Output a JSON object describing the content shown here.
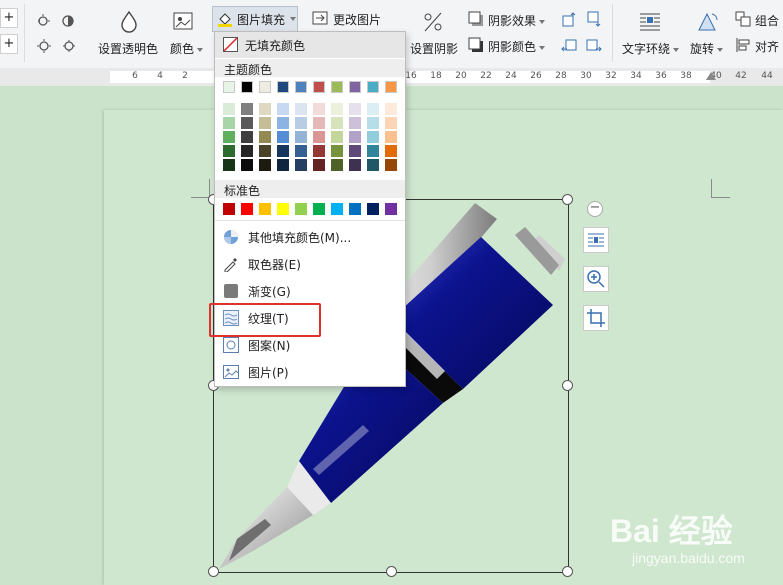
{
  "ribbon": {
    "set_transparent": "设置透明色",
    "color": "颜色",
    "picture_fill": "图片填充",
    "change_picture": "更改图片",
    "shadow_effect": "阴影效果",
    "set_shadow": "设置阴影",
    "shadow_color": "阴影颜色",
    "text_wrap": "文字环绕",
    "rotate": "旋转",
    "group": "组合",
    "align": "对齐"
  },
  "ruler": {
    "left_ticks": [
      "6",
      "4",
      "2"
    ],
    "right_ticks": [
      "16",
      "18",
      "20",
      "22",
      "24",
      "26",
      "28",
      "30",
      "32",
      "34",
      "36",
      "38",
      "40",
      "42",
      "44"
    ]
  },
  "menu": {
    "no_fill": "无填充颜色",
    "theme_colors": "主题颜色",
    "standard_colors": "标准色",
    "more_colors": "其他填充颜色(M)...",
    "eyedropper": "取色器(E)",
    "gradient": "渐变(G)",
    "texture": "纹理(T)",
    "pattern": "图案(N)",
    "picture": "图片(P)"
  },
  "theme_top_row": [
    "#e8f3e8",
    "#000000",
    "#eeece1",
    "#1f497d",
    "#4f81bd",
    "#c0504d",
    "#9bbb59",
    "#8064a2",
    "#4bacc6",
    "#f79646"
  ],
  "theme_shades": [
    [
      "#d8ecd8",
      "#7f7f7f",
      "#ddd9c3",
      "#c6d9f0",
      "#dbe5f1",
      "#f2dcdb",
      "#ebf1dd",
      "#e5e0ec",
      "#dbeef3",
      "#fdeada"
    ],
    [
      "#a8d5a8",
      "#595959",
      "#c4bd97",
      "#8db3e2",
      "#b8cce4",
      "#e5b9b7",
      "#d7e3bc",
      "#ccc1d9",
      "#b7dde8",
      "#fbd5b5"
    ],
    [
      "#5faf5f",
      "#3f3f3f",
      "#938953",
      "#548dd4",
      "#95b3d7",
      "#d99694",
      "#c3d69b",
      "#b2a2c7",
      "#92cddc",
      "#fac08f"
    ],
    [
      "#2e6b2e",
      "#262626",
      "#494429",
      "#17365d",
      "#366092",
      "#953734",
      "#76923c",
      "#5f497a",
      "#31859b",
      "#e36c09"
    ],
    [
      "#173617",
      "#0c0c0c",
      "#1d1b10",
      "#0f243e",
      "#244061",
      "#632423",
      "#4f6128",
      "#3f3151",
      "#205867",
      "#974806"
    ]
  ],
  "standard": [
    "#c00000",
    "#ff0000",
    "#ffc000",
    "#ffff00",
    "#92d050",
    "#00b050",
    "#00b0f0",
    "#0070c0",
    "#002060",
    "#7030a0"
  ],
  "watermark": {
    "brand": "Bai 经验",
    "url": "jingyan.baidu.com"
  }
}
